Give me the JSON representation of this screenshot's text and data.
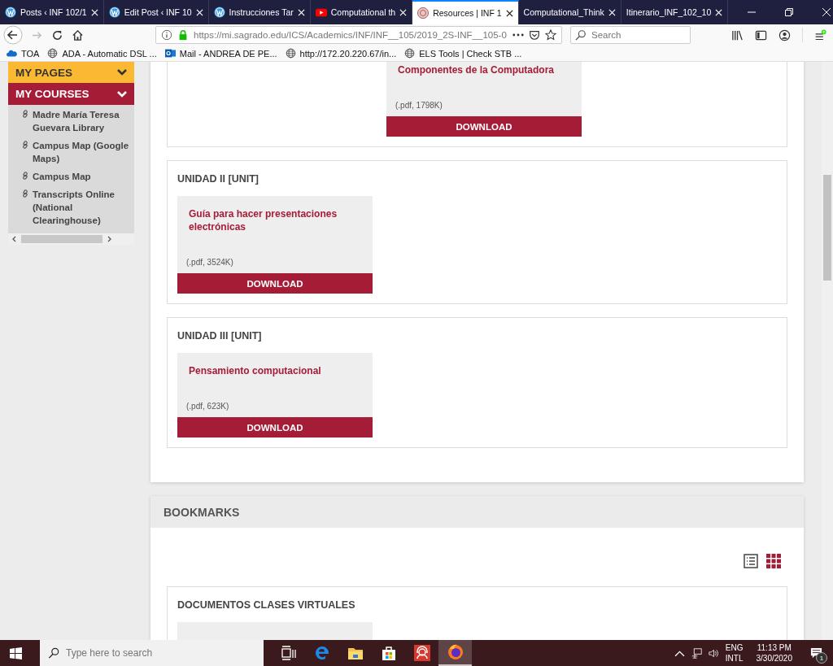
{
  "browser": {
    "tabs": [
      {
        "title": "Posts ‹ INF 102/1",
        "kind": "wordpress",
        "selected": false
      },
      {
        "title": "Edit Post ‹ INF 10",
        "kind": "wordpress",
        "selected": false
      },
      {
        "title": "Instrucciones Tar",
        "kind": "wordpress",
        "selected": false
      },
      {
        "title": "Computational th",
        "kind": "youtube",
        "selected": false
      },
      {
        "title": "Resources | INF 1",
        "kind": "seal",
        "selected": true
      },
      {
        "title": "Computational_Think",
        "kind": "plain",
        "selected": false
      },
      {
        "title": "Itinerario_INF_102_10",
        "kind": "plain",
        "selected": false
      }
    ],
    "url": "https://mi.sagrado.edu/ICS/Academics/INF/INF__105/2019_2S-INF__105-0",
    "search": {
      "placeholder": "Search"
    },
    "bookmarks": [
      {
        "label": "TOA",
        "kind": "cloud"
      },
      {
        "label": "ADA - Automatic DSL ...",
        "kind": "globe"
      },
      {
        "label": "Mail - ANDREA DE PE...",
        "kind": "mail"
      },
      {
        "label": "http://172.20.220.67/in...",
        "kind": "globe"
      },
      {
        "label": "ELS Tools | Check STB ...",
        "kind": "globe"
      }
    ]
  },
  "sidebar": {
    "sections": [
      {
        "title": "MY PAGES",
        "kind": "pages"
      },
      {
        "title": "MY COURSES",
        "kind": "courses"
      }
    ],
    "links": [
      "Madre María Teresa Guevara Library",
      "Campus Map (Google Maps)",
      "Campus Map",
      "Transcripts Online (National Clearinghouse)"
    ]
  },
  "units": [
    {
      "files": [
        {
          "title": "Componentes de la Computadora",
          "size": "(.pdf, 1798K)",
          "button": "DOWNLOAD"
        }
      ]
    },
    {
      "heading": "UNIDAD II [UNIT]",
      "files": [
        {
          "title": "Guía para hacer presentaciones electrónicas",
          "size": "(.pdf, 3524K)",
          "button": "DOWNLOAD"
        }
      ]
    },
    {
      "heading": "UNIDAD III [UNIT]",
      "files": [
        {
          "title": "Pensamiento computacional",
          "size": "(.pdf, 623K)",
          "button": "DOWNLOAD"
        }
      ]
    }
  ],
  "bookmarks_panel": {
    "title": "BOOKMARKS",
    "views": [
      {
        "kind": "list",
        "selected": false
      },
      {
        "kind": "grid",
        "selected": true
      }
    ],
    "folders": [
      {
        "heading": "DOCUMENTOS CLASES VIRTUALES"
      }
    ]
  },
  "taskbar": {
    "search_placeholder": "Type here to search",
    "apps": [
      {
        "kind": "taskview",
        "selected": false
      },
      {
        "kind": "edge",
        "selected": false
      },
      {
        "kind": "explorer",
        "selected": false
      },
      {
        "kind": "store",
        "selected": false
      },
      {
        "kind": "support",
        "selected": false
      },
      {
        "kind": "firefox",
        "selected": true
      }
    ],
    "language": "ENG",
    "layout": "INTL",
    "time": "11:13 PM",
    "date": "3/30/2020",
    "notifications": "1"
  }
}
